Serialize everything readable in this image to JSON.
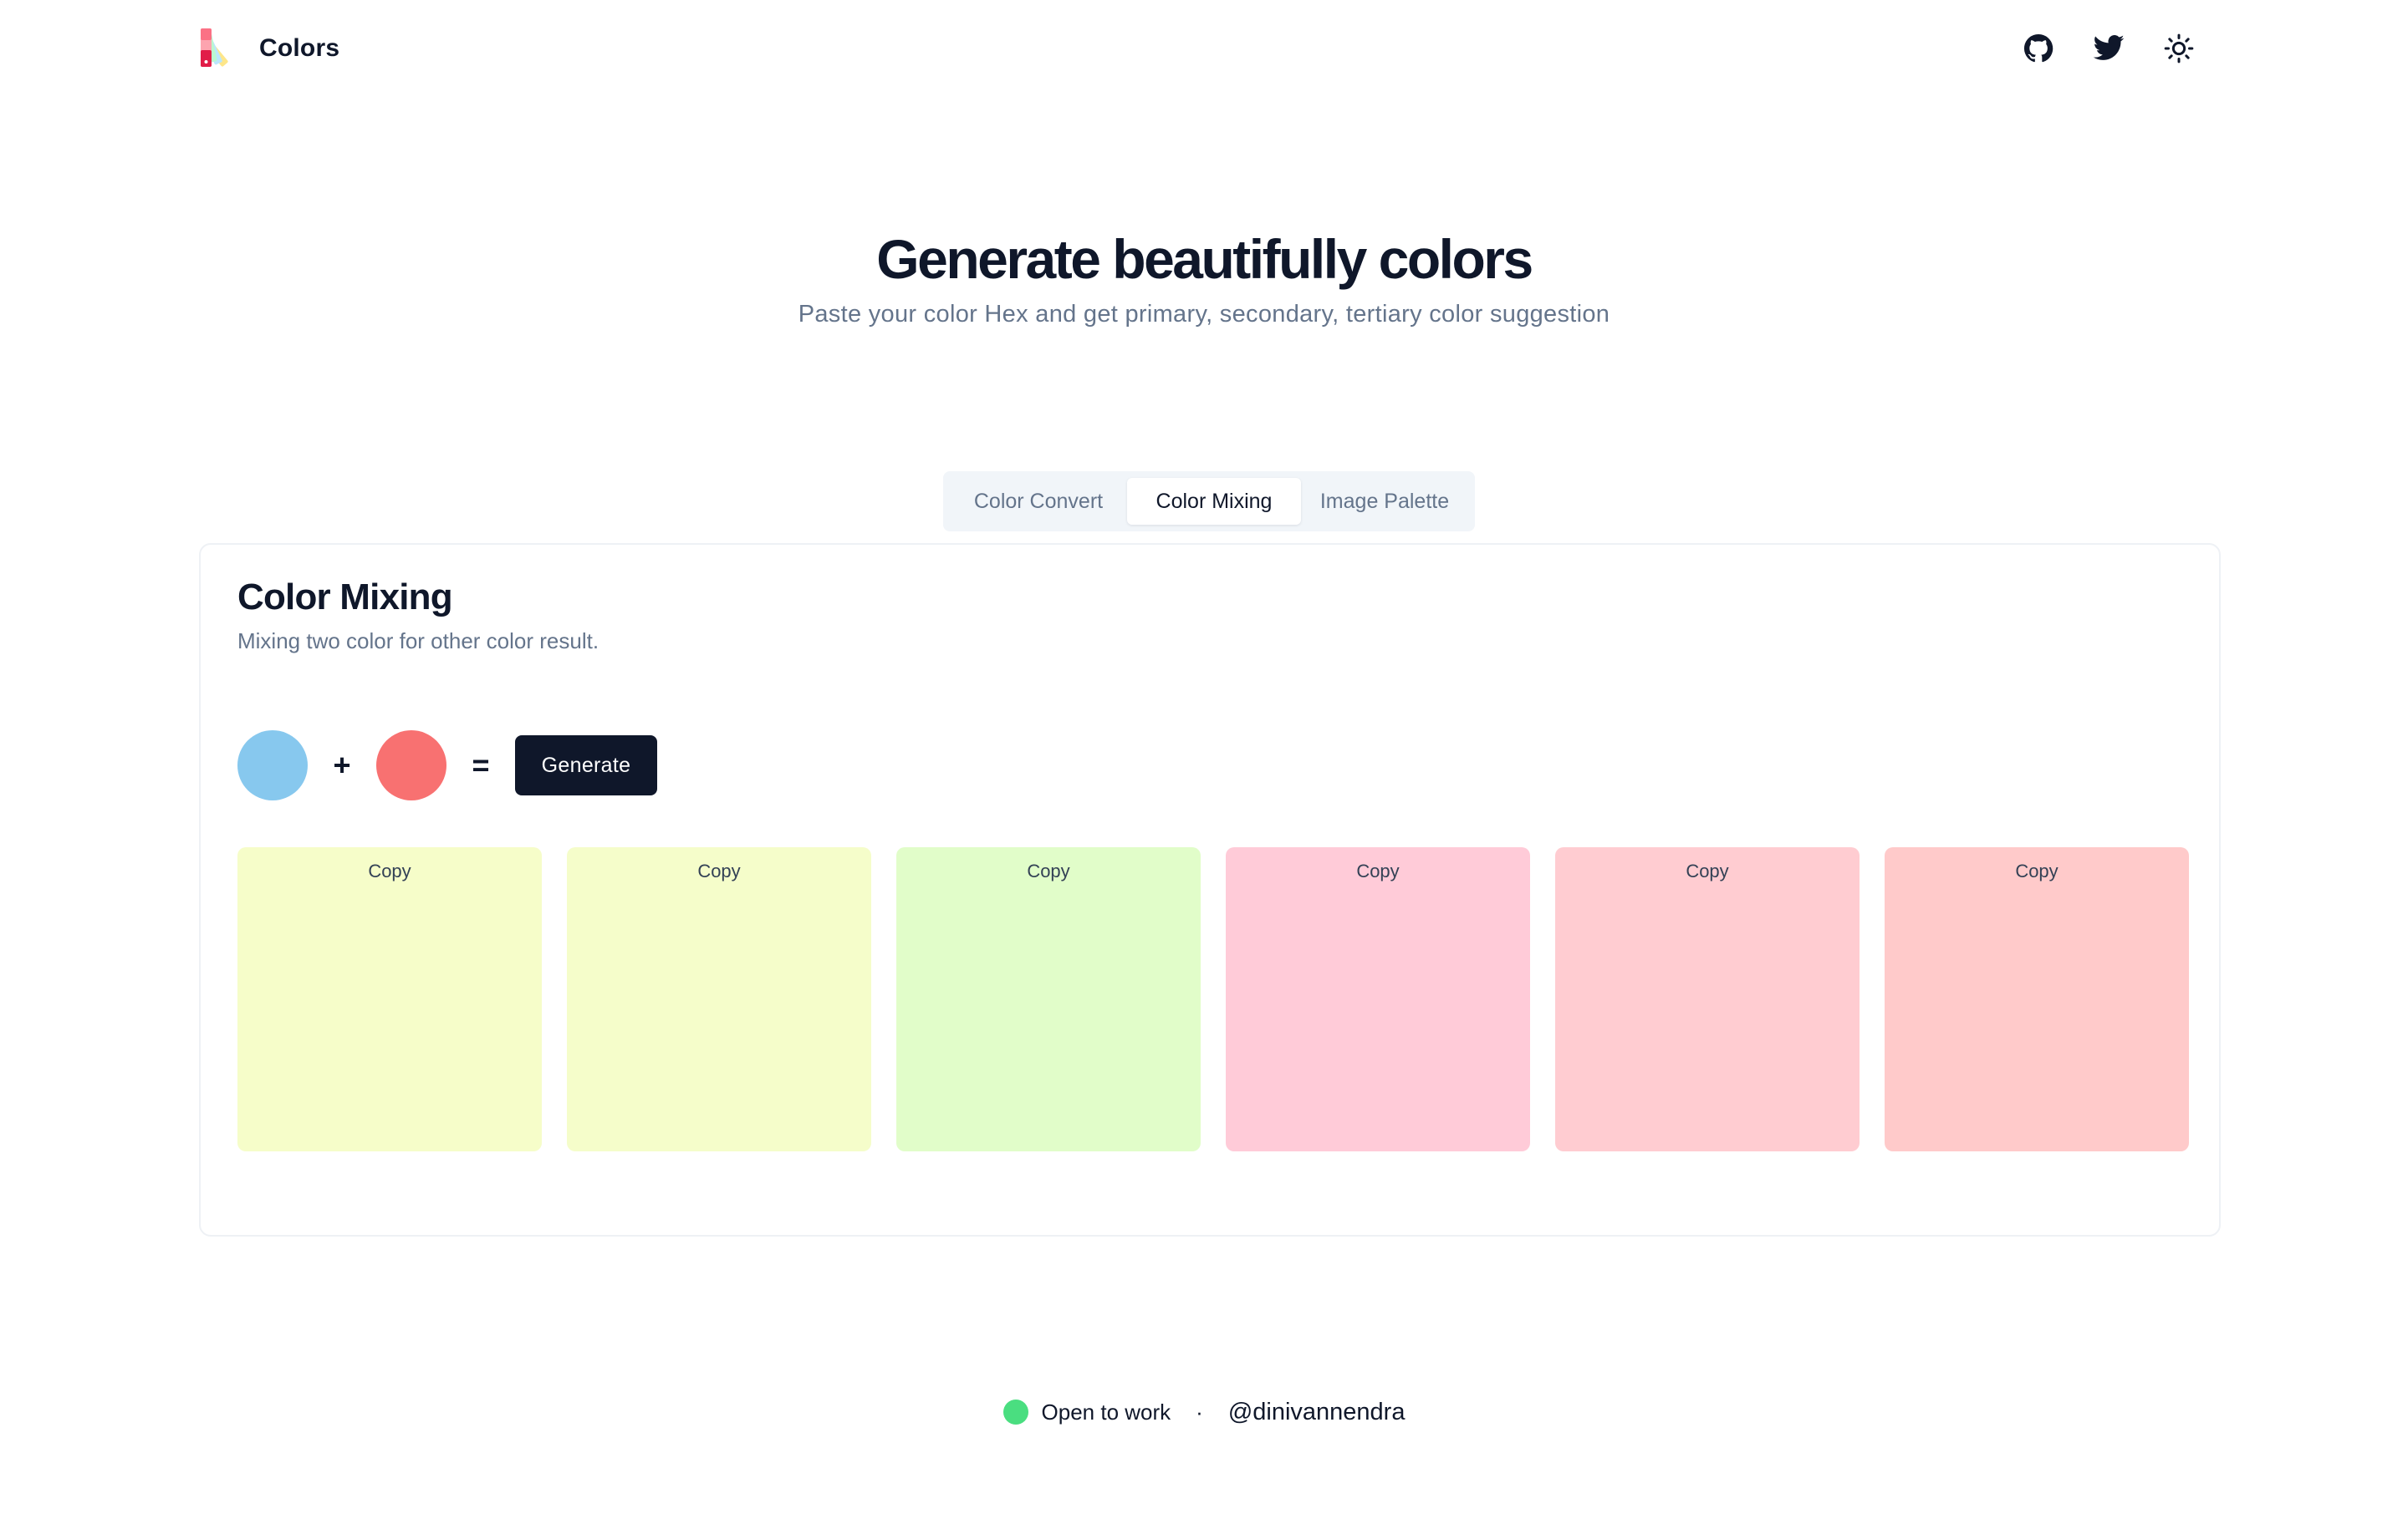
{
  "header": {
    "brand_name": "Colors",
    "icons": [
      "github-icon",
      "twitter-icon",
      "sun-icon"
    ]
  },
  "hero": {
    "title": "Generate beautifully colors",
    "subtitle": "Paste your color Hex and get primary, secondary, tertiary color suggestion"
  },
  "tabs": [
    {
      "label": "Color Convert",
      "active": false
    },
    {
      "label": "Color Mixing",
      "active": true
    },
    {
      "label": "Image Palette",
      "active": false
    }
  ],
  "card": {
    "title": "Color Mixing",
    "description": "Mixing two color for other color result.",
    "color_a": "#87c8ee",
    "plus": "+",
    "color_b": "#f87171",
    "equals": "=",
    "generate_label": "Generate",
    "results": [
      {
        "color": "#f6fdc9",
        "copy_label": "Copy"
      },
      {
        "color": "#f5fdca",
        "copy_label": "Copy"
      },
      {
        "color": "#e1fdc9",
        "copy_label": "Copy"
      },
      {
        "color": "#ffcbd8",
        "copy_label": "Copy"
      },
      {
        "color": "#ffccd1",
        "copy_label": "Copy"
      },
      {
        "color": "#ffcaca",
        "copy_label": "Copy"
      }
    ]
  },
  "footer": {
    "status": "Open to work",
    "status_color": "#4ade80",
    "separator": "·",
    "handle": "@dinivannendra"
  },
  "colors": {
    "text_primary": "#0f172a",
    "text_muted": "#64748b",
    "tab_bg": "#f1f5f9"
  }
}
